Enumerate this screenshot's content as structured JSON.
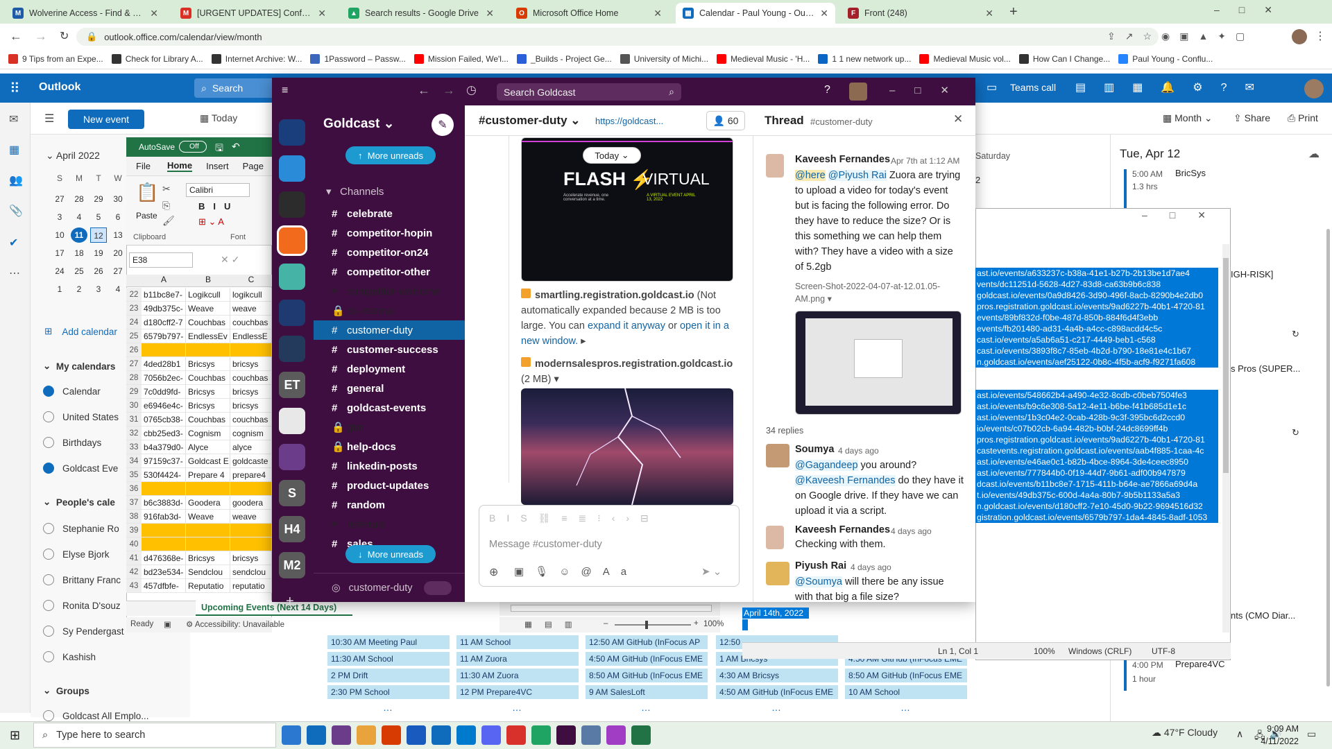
{
  "browser": {
    "tabs": [
      {
        "title": "Wolverine Access - Find & Favori",
        "color": "#1e5aa8",
        "glyph": "M"
      },
      {
        "title": "[URGENT UPDATES] Conference",
        "color": "#d93025",
        "glyph": "M"
      },
      {
        "title": "Search results - Google Drive",
        "color": "#1fa463",
        "glyph": "▲"
      },
      {
        "title": "Microsoft Office Home",
        "color": "#d83b01",
        "glyph": "O"
      },
      {
        "title": "Calendar - Paul Young - Outlook",
        "color": "#0f6cbd",
        "glyph": "▦"
      },
      {
        "title": "Front (248)",
        "color": "#a41f2a",
        "glyph": "F"
      }
    ],
    "url": "outlook.office.com/calendar/view/month",
    "bookmarks": [
      {
        "label": "9 Tips from an Expe...",
        "color": "#d93025"
      },
      {
        "label": "Check for Library A...",
        "color": "#333"
      },
      {
        "label": "Internet Archive: W...",
        "color": "#333"
      },
      {
        "label": "1Password – Passw...",
        "color": "#3b66bc"
      },
      {
        "label": "Mission Failed, We'l...",
        "color": "#ff0000"
      },
      {
        "label": "_Builds - Project Ge...",
        "color": "#2b5fd9"
      },
      {
        "label": "University of Michi...",
        "color": "#555"
      },
      {
        "label": "Medieval Music - 'H...",
        "color": "#ff0000"
      },
      {
        "label": "1 1 new network up...",
        "color": "#0a66c2"
      },
      {
        "label": "Medieval Music vol...",
        "color": "#ff0000"
      },
      {
        "label": "How Can I Change...",
        "color": "#333"
      },
      {
        "label": "Paul Young - Conflu...",
        "color": "#2684ff"
      }
    ]
  },
  "outlook": {
    "app_name": "Outlook",
    "search_placeholder": "Search",
    "new_event": "New event",
    "today": "Today",
    "month_label": "April 2022",
    "weekday_headers": [
      "S",
      "M",
      "T",
      "W"
    ],
    "mini_cal": [
      [
        "27",
        "28",
        "29",
        "30"
      ],
      [
        "3",
        "4",
        "5",
        "6"
      ],
      [
        "10",
        "11",
        "12",
        "13"
      ],
      [
        "17",
        "18",
        "19",
        "20"
      ],
      [
        "24",
        "25",
        "26",
        "27"
      ],
      [
        "1",
        "2",
        "3",
        "4"
      ]
    ],
    "add_calendar": "Add calendar",
    "my_calendars": "My calendars",
    "calendars": [
      {
        "label": "Calendar",
        "on": true
      },
      {
        "label": "United States",
        "on": false
      },
      {
        "label": "Birthdays",
        "on": false
      },
      {
        "label": "Goldcast Eve",
        "on": true
      }
    ],
    "peoples_calendars": "People's cale",
    "people": [
      "Stephanie Ro",
      "Elyse Bjork",
      "Brittany Franc",
      "Ronita D'souz",
      "Sy Pendergast",
      "Kashish"
    ],
    "groups": "Groups",
    "group_item": "Goldcast All Emplo...",
    "teams_call": "Teams call",
    "view_month": "Month",
    "share": "Share",
    "print": "Print",
    "saturday": "Saturday",
    "saturday_num": "2",
    "agenda_date": "Tue, Apr 12",
    "agenda": [
      {
        "time": "5:00 AM",
        "dur": "1.3 hrs",
        "title": "BricSys"
      },
      {
        "time": "4:00 PM",
        "dur": "1 hour",
        "title": "Prepare4VC"
      }
    ],
    "right_labels": [
      "IGH-RISK]",
      "s Pros (SUPER...",
      "nts (CMO Diar..."
    ],
    "bottom_events": [
      [
        "10:30 AM Meeting Paul",
        "11:30 AM School",
        "2 PM Drift",
        "2:30 PM School"
      ],
      [
        "11 AM School",
        "11 AM Zuora",
        "11:30 AM Zuora",
        "12 PM Prepare4VC"
      ],
      [
        "12:50 AM GitHub (InFocus AP",
        "4:50 AM GitHub (InFocus EME",
        "8:50 AM GitHub (InFocus EME",
        "9 AM SalesLoft"
      ],
      [
        "12:50",
        "1 AM Bricsys",
        "4:30 AM Bricsys",
        "4:50 AM GitHub (InFocus EME"
      ],
      [
        "",
        "4:50 AM GitHub (InFocus EME",
        "8:50 AM GitHub (InFocus EME",
        "10 AM School"
      ]
    ]
  },
  "excel": {
    "autosave": "AutoSave",
    "autosave_state": "Off",
    "ribbon_tabs": [
      "File",
      "Home",
      "Insert",
      "Page"
    ],
    "font": "Calibri",
    "paste": "Paste",
    "clipboard": "Clipboard",
    "font_group": "Font",
    "cell_ref": "E38",
    "col_headers": [
      "A",
      "B",
      "C"
    ],
    "rows": [
      {
        "n": "22",
        "a": "b11bc8e7-",
        "b": "Logikcull",
        "c": "logikcull",
        "hl": false
      },
      {
        "n": "23",
        "a": "49db375c-",
        "b": "Weave",
        "c": "weave",
        "hl": false
      },
      {
        "n": "24",
        "a": "d180cff2-7",
        "b": "Couchbas",
        "c": "couchbas",
        "hl": false
      },
      {
        "n": "25",
        "a": "6579b797-",
        "b": "EndlessEv",
        "c": "EndlessE",
        "hl": false
      },
      {
        "n": "26",
        "a": "",
        "b": "",
        "c": "",
        "hl": true
      },
      {
        "n": "27",
        "a": "4ded28b1",
        "b": "Bricsys",
        "c": "bricsys",
        "hl": false
      },
      {
        "n": "28",
        "a": "7056b2ec-",
        "b": "Couchbas",
        "c": "couchbas",
        "hl": false
      },
      {
        "n": "29",
        "a": "7c0dd9fd-",
        "b": "Bricsys",
        "c": "bricsys",
        "hl": false
      },
      {
        "n": "30",
        "a": "e6946e4c-",
        "b": "Bricsys",
        "c": "bricsys",
        "hl": false
      },
      {
        "n": "31",
        "a": "0765cb38-",
        "b": "Couchbas",
        "c": "couchbas",
        "hl": false
      },
      {
        "n": "32",
        "a": "cbb25ed3-",
        "b": "Cognism",
        "c": "cognism",
        "hl": false
      },
      {
        "n": "33",
        "a": "b4a379d0-",
        "b": "Alyce",
        "c": "alyce",
        "hl": false
      },
      {
        "n": "34",
        "a": "97159c37-",
        "b": "Goldcast E",
        "c": "goldcaste",
        "hl": false
      },
      {
        "n": "35",
        "a": "530f4424-",
        "b": "Prepare 4",
        "c": "prepare4",
        "hl": false
      },
      {
        "n": "36",
        "a": "",
        "b": "",
        "c": "",
        "hl": true
      },
      {
        "n": "37",
        "a": "b6c3883d-",
        "b": "Goodera",
        "c": "goodera",
        "hl": false
      },
      {
        "n": "38",
        "a": "916fab3d-",
        "b": "Weave",
        "c": "weave",
        "hl": false
      },
      {
        "n": "39",
        "a": "",
        "b": "",
        "c": "",
        "hl": true
      },
      {
        "n": "40",
        "a": "",
        "b": "",
        "c": "",
        "hl": true
      },
      {
        "n": "41",
        "a": "d476368e-",
        "b": "Bricsys",
        "c": "bricsys",
        "hl": false
      },
      {
        "n": "42",
        "a": "bd23e534-",
        "b": "Sendclou",
        "c": "sendclou",
        "hl": false
      },
      {
        "n": "43",
        "a": "457dfbfe-",
        "b": "Reputatio",
        "c": "reputatio",
        "hl": false
      }
    ],
    "sheet_tab": "Upcoming Events (Next 14 Days)",
    "status": "Ready",
    "accessibility": "Accessibility: Unavailable",
    "zoom": "100%"
  },
  "goldcast": {
    "search": "Search Goldcast",
    "workspace": "Goldcast",
    "more_unreads": "More unreads",
    "channels_header": "Channels",
    "channels": [
      {
        "name": "celebrate",
        "bold": true,
        "lock": false
      },
      {
        "name": "competitor-hopin",
        "bold": true,
        "lock": false
      },
      {
        "name": "competitor-on24",
        "bold": true,
        "lock": false
      },
      {
        "name": "competitor-other",
        "bold": true,
        "lock": false
      },
      {
        "name": "competitor-welcome",
        "bold": false,
        "lock": false
      },
      {
        "name": "cs-internal",
        "bold": false,
        "lock": true
      },
      {
        "name": "customer-duty",
        "bold": false,
        "lock": false,
        "sel": true
      },
      {
        "name": "customer-success",
        "bold": true,
        "lock": false
      },
      {
        "name": "deployment",
        "bold": true,
        "lock": false
      },
      {
        "name": "general",
        "bold": true,
        "lock": false
      },
      {
        "name": "goldcast-events",
        "bold": true,
        "lock": false
      },
      {
        "name": "gtm",
        "bold": false,
        "lock": true
      },
      {
        "name": "help-docs",
        "bold": true,
        "lock": true
      },
      {
        "name": "linkedin-posts",
        "bold": true,
        "lock": false
      },
      {
        "name": "product-updates",
        "bold": true,
        "lock": false
      },
      {
        "name": "random",
        "bold": true,
        "lock": false
      },
      {
        "name": "referrals",
        "bold": false,
        "lock": false
      },
      {
        "name": "sales",
        "bold": true,
        "lock": false
      }
    ],
    "huddle": "customer-duty",
    "ws_icons": [
      {
        "label": "",
        "color": "#1a3d7c"
      },
      {
        "label": "",
        "color": "#2a8bd8"
      },
      {
        "label": "",
        "color": "#2c2c2c"
      },
      {
        "label": "",
        "color": "#f26b1d"
      },
      {
        "label": "",
        "color": "#45b3a6"
      },
      {
        "label": "",
        "color": "#1f3a70"
      },
      {
        "label": "",
        "color": "#233a5c"
      },
      {
        "label": "ET",
        "color": "#5b5b5b"
      },
      {
        "label": "",
        "color": "#e8e8e8"
      },
      {
        "label": "",
        "color": "#6a3c8a"
      },
      {
        "label": "S",
        "color": "#5b5b5b"
      },
      {
        "label": "H4",
        "color": "#5b5b5b"
      },
      {
        "label": "M2",
        "color": "#5b5b5b"
      }
    ],
    "channel_title": "#customer-duty",
    "channel_link": "https://goldcast...",
    "member_count": "60",
    "today_pill": "Today",
    "flash_title": "FLASH",
    "flash_sub": "VIRTUAL",
    "flash_tag": "Accelerate revenue, one conversation at a time.",
    "flash_tag2": "A VIRTUAL EVENT APRIL 13, 2022",
    "file1_name": "smartling.registration.goldcast.io",
    "file1_note_a": "(Not automatically expanded because 2 MB is too large. You can",
    "file1_link1": "expand it anyway",
    "file1_or": "or",
    "file1_link2": "open it in a new window.",
    "file2_name": "modernsalespros.registration.goldcast.io",
    "file2_size": "(2 MB)",
    "composer_placeholder": "Message #customer-duty",
    "thread_title": "Thread",
    "thread_channel": "#customer-duty",
    "op_name": "Kaveesh Fernandes",
    "op_time": "Apr 7th at 1:12 AM",
    "op_here": "@here",
    "op_mention": "@Piyush Rai",
    "op_text": "Zuora are trying to upload a video for today's event but is facing the following error. Do they have to reduce the size? Or is this something we can help them with? They have a video with a size of 5.2gb",
    "op_file": "Screen-Shot-2022-04-07-at-12.01.05-AM.png",
    "replies": "34 replies",
    "r1_name": "Soumya",
    "r1_time": "4 days ago",
    "r1_mention": "@Gagandeep",
    "r1_text1": "you around?",
    "r1_mention2": "@Kaveesh Fernandes",
    "r1_text2": "do they have it on Google drive. If they have we can upload it via a script.",
    "r2_name": "Kaveesh Fernandes",
    "r2_time": "4 days ago",
    "r2_text": "Checking with them.",
    "r3_name": "Piyush Rai",
    "r3_time": "4 days ago",
    "r3_mention": "@Soumya",
    "r3_text": "will there be any issue with that big a file size?"
  },
  "notepad": {
    "lines": [
      "ast.io/events/a633237c-b38a-41e1-b27b-2b13be1d7ae4",
      "vents/dc11251d-5628-4d27-83d8-ca63b9b6c838",
      "goldcast.io/events/0a9d8426-3d90-496f-8acb-8290b4e2db0",
      "pros.registration.goldcast.io/events/9ad6227b-40b1-4720-81",
      "events/89bf832d-f0be-487d-850b-884f6d4f3ebb",
      "events/fb201480-ad31-4a4b-a4cc-c898acdd4c5c",
      "cast.io/events/a5ab6a51-c217-4449-beb1-c568",
      "cast.io/events/3893f8c7-85eb-4b2d-b790-18e81e4c1b67",
      "n.goldcast.io/events/aef25122-0b8c-4f5b-acf9-f9271fa608",
      "",
      "",
      "ast.io/events/548662b4-a490-4e32-8cdb-c0beb7504fe3",
      "ast.io/events/b9c6e308-5a12-4e11-b6be-f41b685d1e1c",
      "ast.io/events/1b3c04e2-0cab-428b-9c3f-395bc6d2ccd0",
      "io/events/c07b02cb-6a94-482b-b0bf-24dc8699ff4b",
      "pros.registration.goldcast.io/events/9ad6227b-40b1-4720-81",
      "castevents.registration.goldcast.io/events/aab4f885-1caa-4c",
      "ast.io/events/e46ae0c1-b82b-4bce-8964-3de4ceec8950",
      "ast.io/events/777844b0-0f19-44d7-9b61-adf00b947879",
      "dcast.io/events/b11bc8e7-1715-411b-b64e-ae7866a69d4a",
      "t.io/events/49db375c-600d-4a4a-80b7-9b5b1133a5a3",
      "n.goldcast.io/events/d180cff2-7e10-45d0-9b22-9694516d32",
      "gistration.goldcast.io/events/6579b797-1da4-4845-8adf-1053"
    ],
    "date_line": "April 14th, 2022",
    "status_pos": "Ln 1, Col 1",
    "status_zoom": "100%",
    "status_eol": "Windows (CRLF)",
    "status_enc": "UTF-8"
  },
  "taskbar": {
    "search": "Type here to search",
    "weather": "47°F  Cloudy",
    "time": "9:09 AM",
    "date": "4/11/2022"
  }
}
